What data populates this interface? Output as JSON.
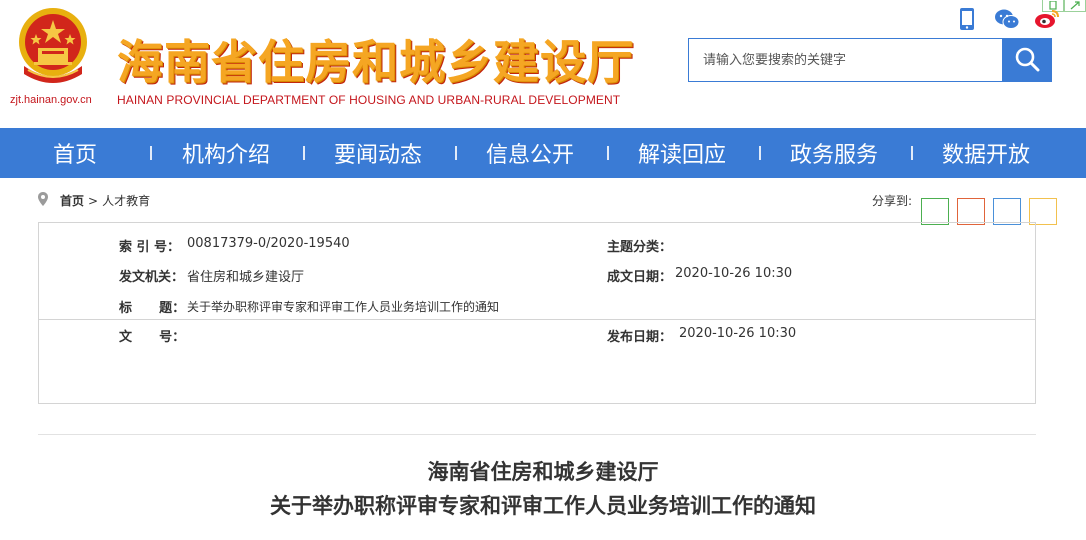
{
  "header": {
    "title_cn": "海南省住房和城乡建设厅",
    "title_en": "HAINAN PROVINCIAL DEPARTMENT OF HOUSING AND URBAN-RURAL DEVELOPMENT",
    "domain": "zjt.hainan.gov.cn"
  },
  "search": {
    "placeholder": "请输入您要搜索的关键字"
  },
  "nav": {
    "items": [
      "首页",
      "机构介绍",
      "要闻动态",
      "信息公开",
      "解读回应",
      "政务服务",
      "数据开放"
    ]
  },
  "breadcrumb": {
    "home": "首页",
    "separator": ">",
    "current": "人才教育"
  },
  "share": {
    "label": "分享到:",
    "colors": [
      "#4caf50",
      "#e0643a",
      "#4a90d9",
      "#f2c14e"
    ]
  },
  "info": {
    "index_label": "索 引 号：",
    "index_value": "00817379-0/2020-19540",
    "topic_label": "主题分类：",
    "topic_value": "",
    "issuer_label": "发文机关：",
    "issuer_value": "省住房和城乡建设厅",
    "date_label": "成文日期：",
    "date_value": "2020-10-26 10:30",
    "title_label": "标      题：",
    "title_value": "关于举办职称评审专家和评审工作人员业务培训工作的通知",
    "docno_label": "文      号：",
    "docno_value": "",
    "publish_label": "发布日期：",
    "publish_value": "2020-10-26 10:30"
  },
  "document": {
    "title_line1": "海南省住房和城乡建设厅",
    "title_line2": "关于举办职称评审专家和评审工作人员业务培训工作的通知"
  }
}
